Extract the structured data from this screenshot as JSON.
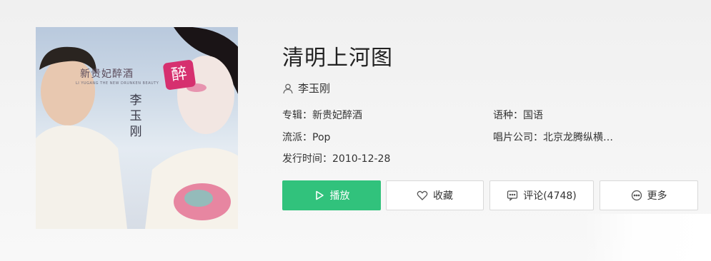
{
  "album": {
    "title": "清明上河图",
    "artist": "李玉刚",
    "album_label": "专辑：",
    "album_value": "新贵妃醉酒",
    "language_label": "语种：",
    "language_value": "国语",
    "genre_label": "流派：",
    "genre_value": "Pop",
    "company_label": "唱片公司：",
    "company_value": "北京龙腾纵横…",
    "release_label": "发行时间：",
    "release_value": "2010-12-28"
  },
  "cover": {
    "logo_text": "新贵妃醉酒",
    "sub_text": "LI YUGANG THE NEW DRUNKEN BEAUTY",
    "vertical_name": "李玉刚",
    "badge_text": "醉"
  },
  "actions": {
    "play": "播放",
    "favorite": "收藏",
    "comment": "评论(4748)",
    "more": "更多"
  },
  "colors": {
    "accent": "#31c27c",
    "text": "#333333",
    "border": "#d9d9d9"
  },
  "icons": {
    "artist": "user-icon",
    "play": "play-icon",
    "favorite": "heart-icon",
    "comment": "comment-icon",
    "more": "more-icon"
  }
}
